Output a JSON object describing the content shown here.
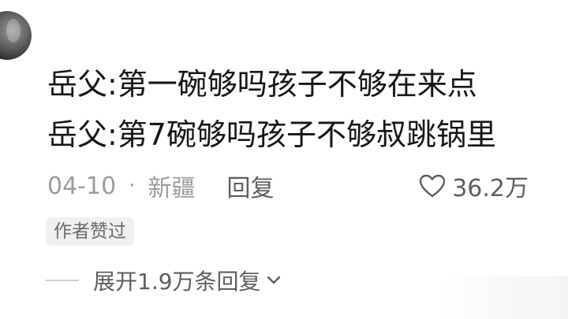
{
  "comment": {
    "lines": [
      "岳父:第一碗够吗孩子不够在来点",
      "岳父:第7碗够吗孩子不够叔跳锅里"
    ],
    "date": "04-10",
    "separator": "·",
    "location": "新疆",
    "reply_label": "回复",
    "likes": "36.2万",
    "author_badge": "作者赞过",
    "expand_label": "展开1.9万条回复"
  },
  "icons": {
    "avatar": "user-avatar",
    "like": "heart-outline-icon",
    "expand": "chevron-down-icon"
  },
  "colors": {
    "text_primary": "#161616",
    "text_secondary": "#9b9b9b",
    "text_action": "#5e5e5e",
    "badge_bg": "#f0f0f0"
  }
}
